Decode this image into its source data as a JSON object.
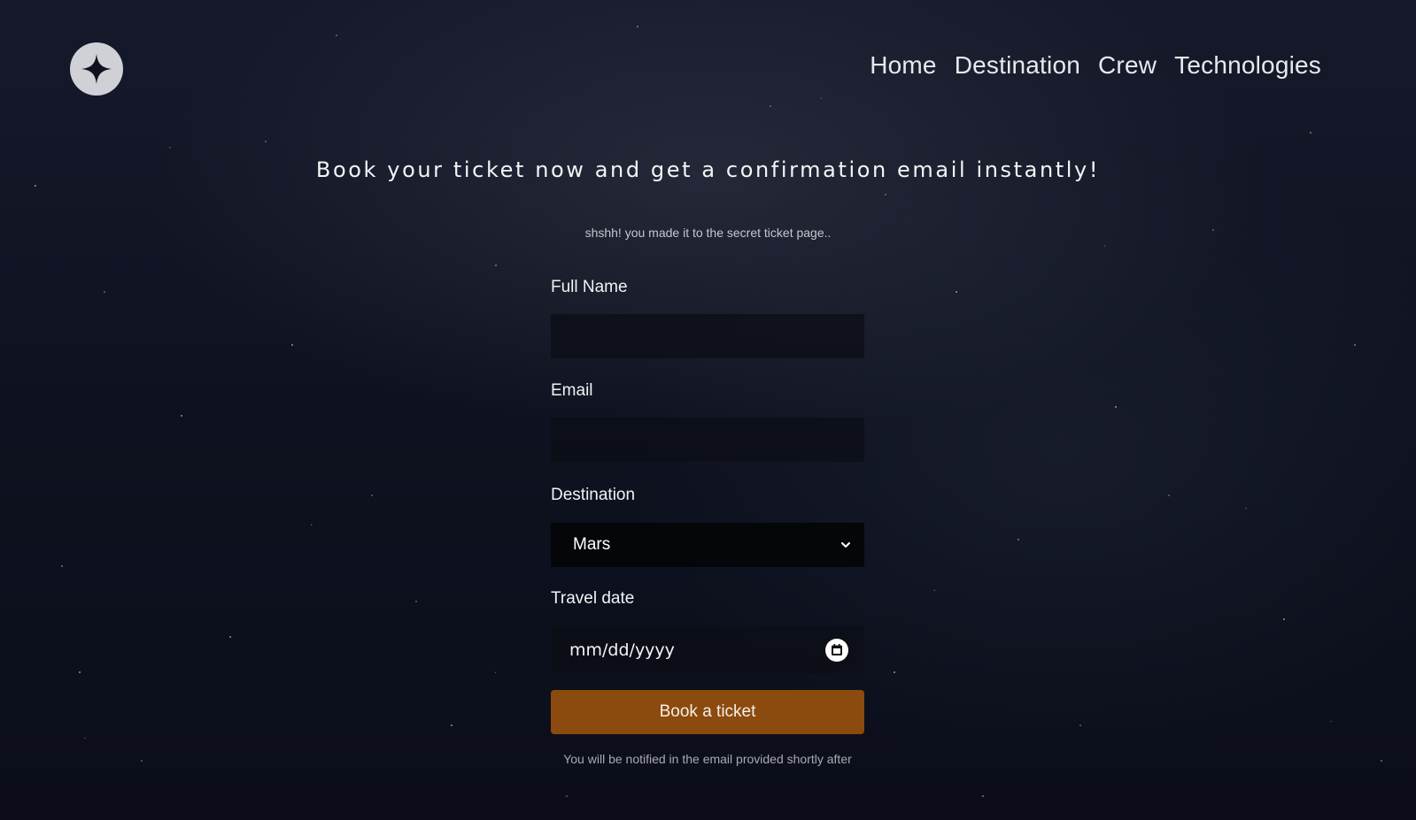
{
  "header": {
    "logo_icon": "star-logo-icon",
    "nav": [
      {
        "label": "Home"
      },
      {
        "label": "Destination"
      },
      {
        "label": "Crew"
      },
      {
        "label": "Technologies"
      }
    ]
  },
  "main": {
    "headline": "Book your ticket now and get a confirmation email instantly!",
    "subline": "shshh! you made it to the secret ticket page.."
  },
  "form": {
    "full_name": {
      "label": "Full Name",
      "value": "",
      "placeholder": ""
    },
    "email": {
      "label": "Email",
      "value": "",
      "placeholder": ""
    },
    "destination": {
      "label": "Destination",
      "selected": "Mars",
      "icon": "chevron-down-icon"
    },
    "travel_date": {
      "label": "Travel date",
      "value": "mm/dd/yyyy",
      "icon": "calendar-icon"
    },
    "submit_label": "Book a ticket",
    "note": "You will be notified in the email provided shortly after"
  },
  "colors": {
    "background": "#0e1220",
    "button": "#8b4a0e",
    "select_bg": "#05060a",
    "text": "#ffffff"
  }
}
